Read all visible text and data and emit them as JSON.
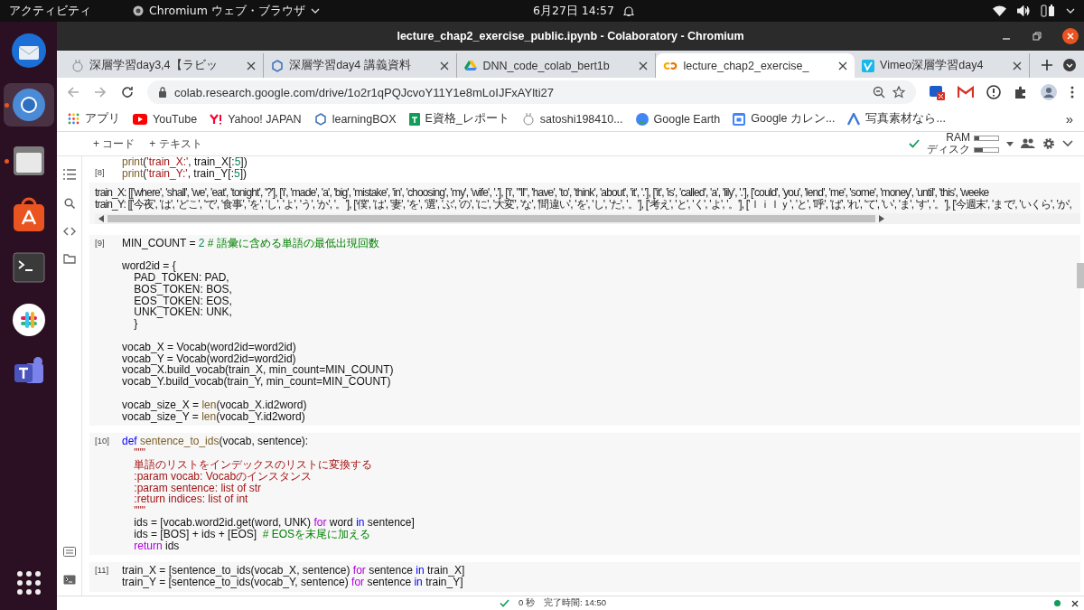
{
  "top_bar": {
    "activities": "アクティビティ",
    "app_menu": "Chromium ウェブ・ブラウザ",
    "clock": "6月27日  14:57"
  },
  "window": {
    "title": "lecture_chap2_exercise_public.ipynb - Colaboratory - Chromium"
  },
  "tabs": [
    {
      "label": "深層学習day3,4【ラビッ",
      "selected": false
    },
    {
      "label": "深層学習day4 講義資料",
      "selected": false
    },
    {
      "label": "DNN_code_colab_bert1b",
      "selected": false
    },
    {
      "label": "lecture_chap2_exercise_",
      "selected": true
    },
    {
      "label": "Vimeo深層学習day4",
      "selected": false
    }
  ],
  "address_bar": {
    "url": "colab.research.google.com/drive/1o2r1qPQJcvoY11Y1e8mLoIJFxAYlti27"
  },
  "bookmarks": [
    "アプリ",
    "YouTube",
    "Yahoo! JAPAN",
    "learningBOX",
    "E資格_レポート",
    "satoshi198410...",
    "Google Earth",
    "Google カレン...",
    "写真素材なら..."
  ],
  "bookmarks_more": "»",
  "colab_toolbar": {
    "buttons": [
      "+ コード",
      "+ テキスト"
    ],
    "resources": [
      {
        "label": "RAM",
        "level": 0.2
      },
      {
        "label": "ディスク",
        "level": 0.35
      }
    ]
  },
  "cells": [
    {
      "number": "[8]",
      "lines": [
        {
          "kind": "code",
          "segs": [
            {
              "text": "print",
              "kind": "func"
            },
            {
              "text": "(",
              "kind": "plain"
            },
            {
              "text": "'train_X:'",
              "kind": "string"
            },
            {
              "text": ", train_X[:",
              "kind": "plain"
            },
            {
              "text": "5",
              "kind": "number"
            },
            {
              "text": "])",
              "kind": "plain"
            }
          ]
        },
        {
          "kind": "code",
          "segs": [
            {
              "text": "print",
              "kind": "func"
            },
            {
              "text": "(",
              "kind": "plain"
            },
            {
              "text": "'train_Y:'",
              "kind": "string"
            },
            {
              "text": ", train_Y[:",
              "kind": "plain"
            },
            {
              "text": "5",
              "kind": "number"
            },
            {
              "text": "])",
              "kind": "plain"
            }
          ]
        }
      ],
      "output": [
        "train_X: [['where', 'shall', 'we', 'eat', 'tonight', '?'], ['i', 'made', 'a', 'big', 'mistake', 'in', 'choosing', 'my', 'wife', '.'], ['i', \"'ll\", 'have', 'to', 'think', 'about', 'it', '.'], ['it', 'is', 'called', 'a', 'lily', '.'], ['could', 'you', 'lend', 'me', 'some', 'money', 'until', 'this', 'weeke",
        "train_Y: [['今夜', 'は', 'どこ', 'で', '食事', 'を', 'し', 'よ', 'う', 'か', '。'], ['僕', 'は', '妻', 'を', '選', 'ぶ', 'の', 'に', '大変', 'な', '間違い', 'を', 'し', 'た', '。'], ['考え', 'と', 'く', 'よ', '。'], ['ｌｉｌｙ', 'と', '呼', 'ば', 'れ', 'て', 'い', 'ま', 'す', '。'], ['今週末', 'まで', 'いくら', 'か',"
      ]
    },
    {
      "number": "[9]",
      "lines": [
        {
          "kind": "code",
          "segs": [
            {
              "text": "MIN_COUNT = ",
              "kind": "plain"
            },
            {
              "text": "2",
              "kind": "number"
            },
            {
              "text": " # 語彙に含める単語の最低出現回数",
              "kind": "comment"
            }
          ]
        },
        {
          "kind": "blank"
        },
        {
          "kind": "code",
          "segs": [
            {
              "text": "word2id = {",
              "kind": "plain"
            }
          ]
        },
        {
          "kind": "code",
          "segs": [
            {
              "text": "    PAD_TOKEN: PAD,",
              "kind": "plain"
            }
          ]
        },
        {
          "kind": "code",
          "segs": [
            {
              "text": "    BOS_TOKEN: BOS,",
              "kind": "plain"
            }
          ]
        },
        {
          "kind": "code",
          "segs": [
            {
              "text": "    EOS_TOKEN: EOS,",
              "kind": "plain"
            }
          ]
        },
        {
          "kind": "code",
          "segs": [
            {
              "text": "    UNK_TOKEN: UNK,",
              "kind": "plain"
            }
          ]
        },
        {
          "kind": "code",
          "segs": [
            {
              "text": "    }",
              "kind": "plain"
            }
          ]
        },
        {
          "kind": "blank"
        },
        {
          "kind": "code",
          "segs": [
            {
              "text": "vocab_X = Vocab(word2id=word2id)",
              "kind": "plain"
            }
          ]
        },
        {
          "kind": "code",
          "segs": [
            {
              "text": "vocab_Y = Vocab(word2id=word2id)",
              "kind": "plain"
            }
          ]
        },
        {
          "kind": "code",
          "segs": [
            {
              "text": "vocab_X.build_vocab(train_X, min_count=MIN_COUNT)",
              "kind": "plain"
            }
          ]
        },
        {
          "kind": "code",
          "segs": [
            {
              "text": "vocab_Y.build_vocab(train_Y, min_count=MIN_COUNT)",
              "kind": "plain"
            }
          ]
        },
        {
          "kind": "blank"
        },
        {
          "kind": "code",
          "segs": [
            {
              "text": "vocab_size_X = ",
              "kind": "plain"
            },
            {
              "text": "len",
              "kind": "func"
            },
            {
              "text": "(vocab_X.id2word)",
              "kind": "plain"
            }
          ]
        },
        {
          "kind": "code",
          "segs": [
            {
              "text": "vocab_size_Y = ",
              "kind": "plain"
            },
            {
              "text": "len",
              "kind": "func"
            },
            {
              "text": "(vocab_Y.id2word)",
              "kind": "plain"
            }
          ]
        }
      ]
    },
    {
      "number": "[10]",
      "lines": [
        {
          "kind": "code",
          "segs": [
            {
              "text": "def",
              "kind": "keyword"
            },
            {
              "text": " sentence_to_ids",
              "kind": "func"
            },
            {
              "text": "(vocab, sentence):",
              "kind": "plain"
            }
          ]
        },
        {
          "kind": "code",
          "segs": [
            {
              "text": "    \"\"\"",
              "kind": "string"
            }
          ]
        },
        {
          "kind": "code",
          "segs": [
            {
              "text": "    単語のリストをインデックスのリストに変換する",
              "kind": "string"
            }
          ]
        },
        {
          "kind": "code",
          "segs": [
            {
              "text": "    :param vocab: Vocabのインスタンス",
              "kind": "string"
            }
          ]
        },
        {
          "kind": "code",
          "segs": [
            {
              "text": "    :param sentence: list of str",
              "kind": "string"
            }
          ]
        },
        {
          "kind": "code",
          "segs": [
            {
              "text": "    :return indices: list of int",
              "kind": "string"
            }
          ]
        },
        {
          "kind": "code",
          "segs": [
            {
              "text": "    \"\"\"",
              "kind": "string"
            }
          ]
        },
        {
          "kind": "code",
          "segs": [
            {
              "text": "    ids = [vocab.word2id.get(word, UNK) ",
              "kind": "plain"
            },
            {
              "text": "for",
              "kind": "control"
            },
            {
              "text": " word ",
              "kind": "plain"
            },
            {
              "text": "in",
              "kind": "keyword"
            },
            {
              "text": " sentence]",
              "kind": "plain"
            }
          ]
        },
        {
          "kind": "code",
          "segs": [
            {
              "text": "    ids = [BOS] + ids + [EOS]  ",
              "kind": "plain"
            },
            {
              "text": "# EOSを末尾に加える",
              "kind": "comment"
            }
          ]
        },
        {
          "kind": "code",
          "segs": [
            {
              "text": "    return",
              "kind": "control"
            },
            {
              "text": " ids",
              "kind": "plain"
            }
          ]
        }
      ]
    },
    {
      "number": "[11]",
      "lines": [
        {
          "kind": "code",
          "segs": [
            {
              "text": "train_X = [sentence_to_ids(vocab_X, sentence) ",
              "kind": "plain"
            },
            {
              "text": "for",
              "kind": "control"
            },
            {
              "text": " sentence ",
              "kind": "plain"
            },
            {
              "text": "in",
              "kind": "keyword"
            },
            {
              "text": " train_X]",
              "kind": "plain"
            }
          ]
        },
        {
          "kind": "code",
          "segs": [
            {
              "text": "train_Y = [sentence_to_ids(vocab_Y, sentence) ",
              "kind": "plain"
            },
            {
              "text": "for",
              "kind": "control"
            },
            {
              "text": " sentence ",
              "kind": "plain"
            },
            {
              "text": "in",
              "kind": "keyword"
            },
            {
              "text": " train_Y]",
              "kind": "plain"
            }
          ]
        }
      ]
    }
  ],
  "status_bar": {
    "duration": "0 秒",
    "finished": "完了時間: 14:50"
  }
}
